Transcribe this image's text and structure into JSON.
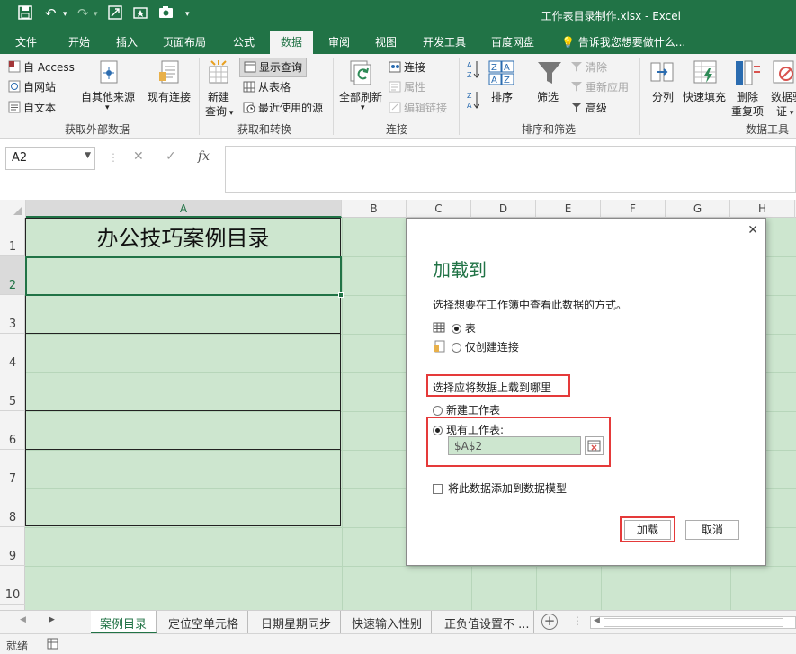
{
  "window": {
    "title": "工作表目录制作.xlsx - Excel"
  },
  "tabs": [
    "文件",
    "开始",
    "插入",
    "页面布局",
    "公式",
    "数据",
    "审阅",
    "视图",
    "开发工具",
    "百度网盘"
  ],
  "active_tab": "数据",
  "tell_me": "告诉我您想要做什么...",
  "ribbon": {
    "get_external": {
      "access": "自 Access",
      "web": "自网站",
      "text": "自文本",
      "other": "自其他来源",
      "existing": "现有连接",
      "label": "获取外部数据"
    },
    "get_transform": {
      "new_query": "新建",
      "new_query2": "查询",
      "show_queries": "显示查询",
      "from_table": "从表格",
      "recent_sources": "最近使用的源",
      "label": "获取和转换"
    },
    "connections": {
      "refresh_all": "全部刷新",
      "connections": "连接",
      "properties": "属性",
      "edit_links": "编辑链接",
      "label": "连接"
    },
    "sort_filter": {
      "sort": "排序",
      "filter": "筛选",
      "clear": "清除",
      "reapply": "重新应用",
      "advanced": "高级",
      "label": "排序和筛选"
    },
    "data_tools": {
      "text_to_columns": "分列",
      "flash_fill": "快速填充",
      "remove_dup1": "删除",
      "remove_dup2": "重复项",
      "validation1": "数据验",
      "validation2": "证",
      "label": "数据工具"
    }
  },
  "formula_bar": {
    "name_box": "A2",
    "formula": ""
  },
  "columns": [
    "A",
    "B",
    "C",
    "D",
    "E",
    "F",
    "G",
    "H"
  ],
  "rows": [
    "1",
    "2",
    "3",
    "4",
    "5",
    "6",
    "7",
    "8",
    "9",
    "10"
  ],
  "cells": {
    "A1": "办公技巧案例目录"
  },
  "dialog": {
    "title": "加载到",
    "prompt": "选择想要在工作簿中查看此数据的方式。",
    "view_options": [
      {
        "label": "表",
        "selected": true
      },
      {
        "label": "仅创建连接",
        "selected": false
      }
    ],
    "location_prompt": "选择应将数据上载到哪里",
    "location_options": [
      {
        "label": "新建工作表",
        "selected": false
      },
      {
        "label": "现有工作表:",
        "selected": true
      }
    ],
    "location_ref": "$A$2",
    "add_model": "将此数据添加到数据模型",
    "load_button": "加载",
    "cancel_button": "取消"
  },
  "sheets": [
    "案例目录",
    "定位空单元格",
    "日期星期同步",
    "快速输入性别",
    "正负值设置不 ..."
  ],
  "active_sheet": "案例目录",
  "status": "就绪",
  "colors": {
    "accent": "#217346",
    "grid_fill": "#cde6cf",
    "highlight": "#e53a3a"
  }
}
